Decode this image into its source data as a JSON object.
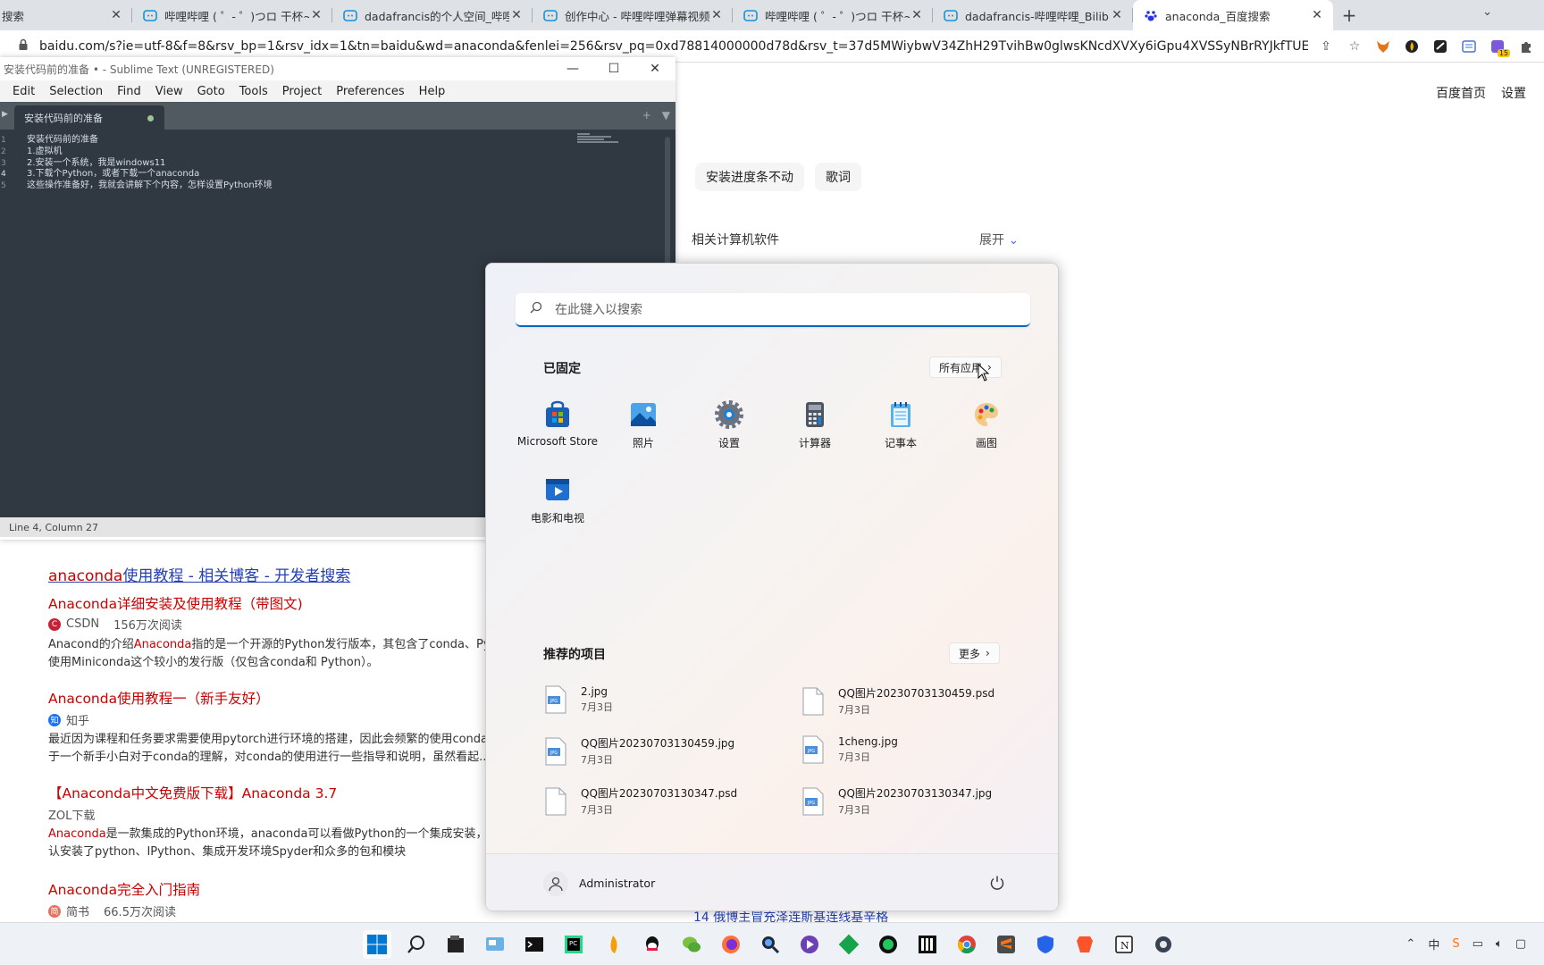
{
  "browser": {
    "tabs": [
      {
        "title": "搜索",
        "icon": "baidu-icon",
        "active": false
      },
      {
        "title": "哔哩哔哩 ( ゜- ゜)つロ 干杯~-bilibili",
        "icon": "bilibili-icon",
        "active": false
      },
      {
        "title": "dadafrancis的个人空间_哔哩哔哩",
        "icon": "bilibili-icon",
        "active": false
      },
      {
        "title": "创作中心 - 哔哩哔哩弹幕视频网",
        "icon": "bilibili-icon",
        "active": false
      },
      {
        "title": "哔哩哔哩 ( ゜- ゜)つロ 干杯~-bilibili",
        "icon": "bilibili-icon",
        "active": false
      },
      {
        "title": "dadafrancis-哔哩哔哩_Bilibili",
        "icon": "bilibili-icon",
        "active": false
      },
      {
        "title": "anaconda_百度搜索",
        "icon": "baidu-paw-icon",
        "active": true
      }
    ],
    "url": "baidu.com/s?ie=utf-8&f=8&rsv_bp=1&rsv_idx=1&tn=baidu&wd=anaconda&fenlei=256&rsv_pq=0xd78814000000d78d&rsv_t=37d5MWiybwV34ZhH29TvihBw0glwsKNcdXVXy6iGpu4XVSSyNBrRYJkfTUEt&rqI...",
    "extension_badge": "15"
  },
  "baidu": {
    "top_links": [
      "百度首页",
      "设置"
    ],
    "chips": [
      "安装进度条不动",
      "歌词"
    ],
    "related_title": "相关计算机软件",
    "expand_label": "展开",
    "main_result": {
      "hl": "anaconda",
      "rest": "使用教程 - 相关博客 - 开发者搜索"
    },
    "results": [
      {
        "title_hl": "Anaconda",
        "title_rest": "详细安装及使用教程（带图文)",
        "source": "CSDN",
        "reads": "156万次阅读",
        "desc1_a": "Anacond的介绍",
        "desc1_hl": "Anaconda",
        "desc1_b": "指的是一个开源的Python发行版本，其包含了conda、Pytho",
        "desc2": "使用Miniconda这个较小的发行版（仅包含conda和 Python）。"
      },
      {
        "title_hl": "Anaconda",
        "title_rest": "使用教程一（新手友好）",
        "source": "知乎",
        "reads": "",
        "desc1_a": "最近因为课程和任务要求需要使用pytorch进行环境的搭建，因此会频繁的使用conda，",
        "desc1_hl": "",
        "desc1_b": "",
        "desc2": "于一个新手小白对于conda的理解，对conda的使用进行一些指导和说明，虽然看起..."
      },
      {
        "title_hl": "【Anaconda中文免费版下载】",
        "title_rest": "Anaconda 3.7",
        "source": "ZOL下载",
        "reads": "",
        "desc1_a": "",
        "desc1_hl": "Anaconda",
        "desc1_b": "是一款集成的Python环境，anaconda可以看做Python的一个集成安装，安装",
        "desc2": "认安装了python、IPython、集成开发环境Spyder和众多的包和模块"
      },
      {
        "title_hl": "Anaconda",
        "title_rest": "完全入门指南",
        "source": "简书",
        "reads": "66.5万次阅读",
        "desc1_a": "",
        "desc1_hl": "",
        "desc1_b": "",
        "desc2": ""
      }
    ],
    "bottom_news": "14  俄博主冒充泽连斯基连线基辛格"
  },
  "sublime": {
    "title": "安装代码前的准备 • - Sublime Text (UNREGISTERED)",
    "menu": [
      "Edit",
      "Selection",
      "Find",
      "View",
      "Goto",
      "Tools",
      "Project",
      "Preferences",
      "Help"
    ],
    "tab": "安装代码前的准备",
    "lines": [
      "1",
      "2",
      "3",
      "4",
      "5"
    ],
    "code": "安装代码前的准备\n1.虚拟机\n2.安装一个系统，我是windows11\n3.下载个Python，或者下载一个anaconda\n这些操作准备好，我就会讲解下个内容，怎样设置Python环境",
    "status": "Line 4, Column 27"
  },
  "start_menu": {
    "search_placeholder": "在此键入以搜索",
    "pinned_heading": "已固定",
    "all_apps": "所有应用",
    "apps": [
      {
        "label": "Microsoft Store",
        "icon": "store-icon"
      },
      {
        "label": "照片",
        "icon": "photos-icon"
      },
      {
        "label": "设置",
        "icon": "settings-gear-icon"
      },
      {
        "label": "计算器",
        "icon": "calculator-icon"
      },
      {
        "label": "记事本",
        "icon": "notepad-icon"
      },
      {
        "label": "画图",
        "icon": "paint-palette-icon"
      },
      {
        "label": "电影和电视",
        "icon": "movies-tv-icon"
      }
    ],
    "recommended_heading": "推荐的项目",
    "more": "更多",
    "recommended": [
      {
        "name": "2.jpg",
        "date": "7月3日",
        "type": "jpg"
      },
      {
        "name": "QQ图片20230703130459.psd",
        "date": "7月3日",
        "type": "psd"
      },
      {
        "name": "QQ图片20230703130459.jpg",
        "date": "7月3日",
        "type": "jpg"
      },
      {
        "name": "1cheng.jpg",
        "date": "7月3日",
        "type": "jpg"
      },
      {
        "name": "QQ图片20230703130347.psd",
        "date": "7月3日",
        "type": "psd"
      },
      {
        "name": "QQ图片20230703130347.jpg",
        "date": "7月3日",
        "type": "jpg"
      }
    ],
    "user": "Administrator"
  },
  "taskbar": {
    "icons": [
      "windows-start-icon",
      "search-icon",
      "file-explorer-icon",
      "control-panel-icon",
      "terminal-icon",
      "pycharm-icon",
      "app-flame-icon",
      "qq-icon",
      "wechat-icon",
      "firefox-icon",
      "search-app-icon",
      "obs-icon",
      "git-icon",
      "app-green-icon",
      "jetbrains-icon",
      "chrome-icon",
      "sublime-icon",
      "shield-app-icon",
      "brave-icon",
      "notion-icon",
      "gear-app-icon"
    ],
    "ime": "中"
  }
}
